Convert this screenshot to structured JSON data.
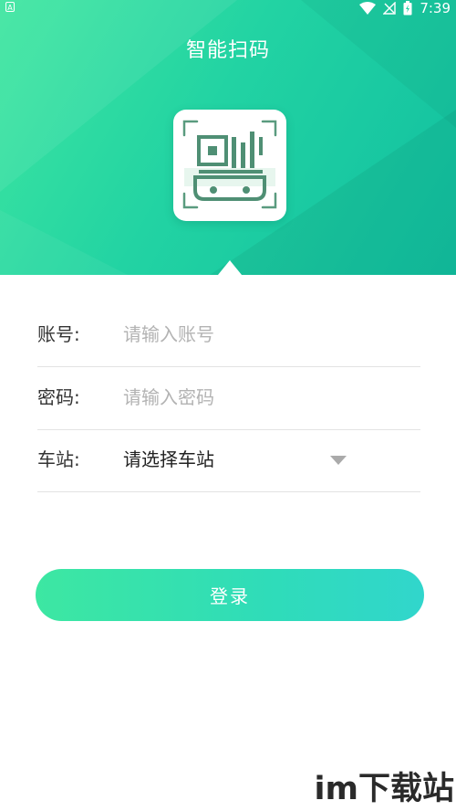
{
  "status_bar": {
    "time": "7:39",
    "left_icon_glyph": "A",
    "icons": [
      "wifi-icon",
      "signal-off-icon",
      "battery-charging-icon"
    ]
  },
  "header": {
    "title": "智能扫码",
    "logo_icon": "qr-scan-train-icon"
  },
  "form": {
    "account": {
      "label": "账号:",
      "placeholder": "请输入账号",
      "value": ""
    },
    "password": {
      "label": "密码:",
      "placeholder": "请输入密码",
      "value": ""
    },
    "station": {
      "label": "车站:",
      "selected": "请选择车站",
      "icon": "chevron-down-icon"
    }
  },
  "login_button": {
    "label": "登录"
  },
  "watermark": {
    "text": "im下载站"
  },
  "colors": {
    "header_start": "#3ee6a0",
    "header_end": "#11bfa0",
    "logo_stroke": "#4f8f74",
    "button_start": "#3de7a2",
    "button_end": "#31d6cc",
    "divider": "#e3e3e3"
  }
}
